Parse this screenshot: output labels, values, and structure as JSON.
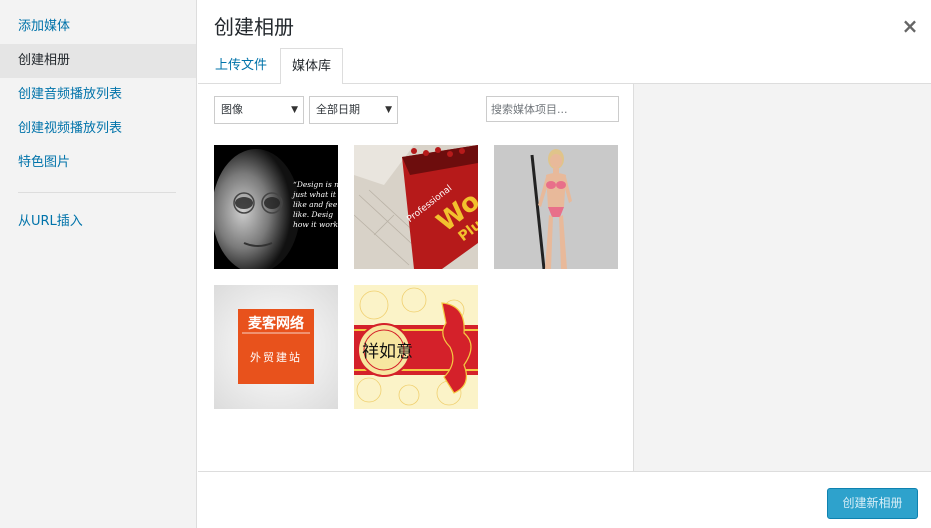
{
  "menu": {
    "items": [
      {
        "label": "添加媒体"
      },
      {
        "label": "创建相册"
      },
      {
        "label": "创建音频播放列表"
      },
      {
        "label": "创建视频播放列表"
      },
      {
        "label": "特色图片"
      }
    ],
    "url_insert": "从URL插入"
  },
  "title": "创建相册",
  "close_glyph": "×",
  "tabs": {
    "upload": "上传文件",
    "library": "媒体库"
  },
  "filters": {
    "type": "图像",
    "date": "全部日期",
    "search_placeholder": "搜索媒体项目..."
  },
  "thumbnails": [
    {
      "caption_lines": [
        "“Design is n",
        "just what it",
        "like and fee",
        "like. Desig",
        "how it work"
      ]
    },
    {
      "caption_lines": [
        "Professional",
        "Wo",
        "Plu"
      ]
    },
    {
      "caption_lines": []
    },
    {
      "caption_lines": [
        "麦客网络",
        "外贸建站"
      ]
    },
    {
      "caption_lines": [
        "祥如意"
      ]
    }
  ],
  "footer": {
    "primary_button": "创建新相册"
  },
  "colors": {
    "link": "#0073aa",
    "primary": "#2ea2cc",
    "logo_orange": "#e8521c"
  }
}
